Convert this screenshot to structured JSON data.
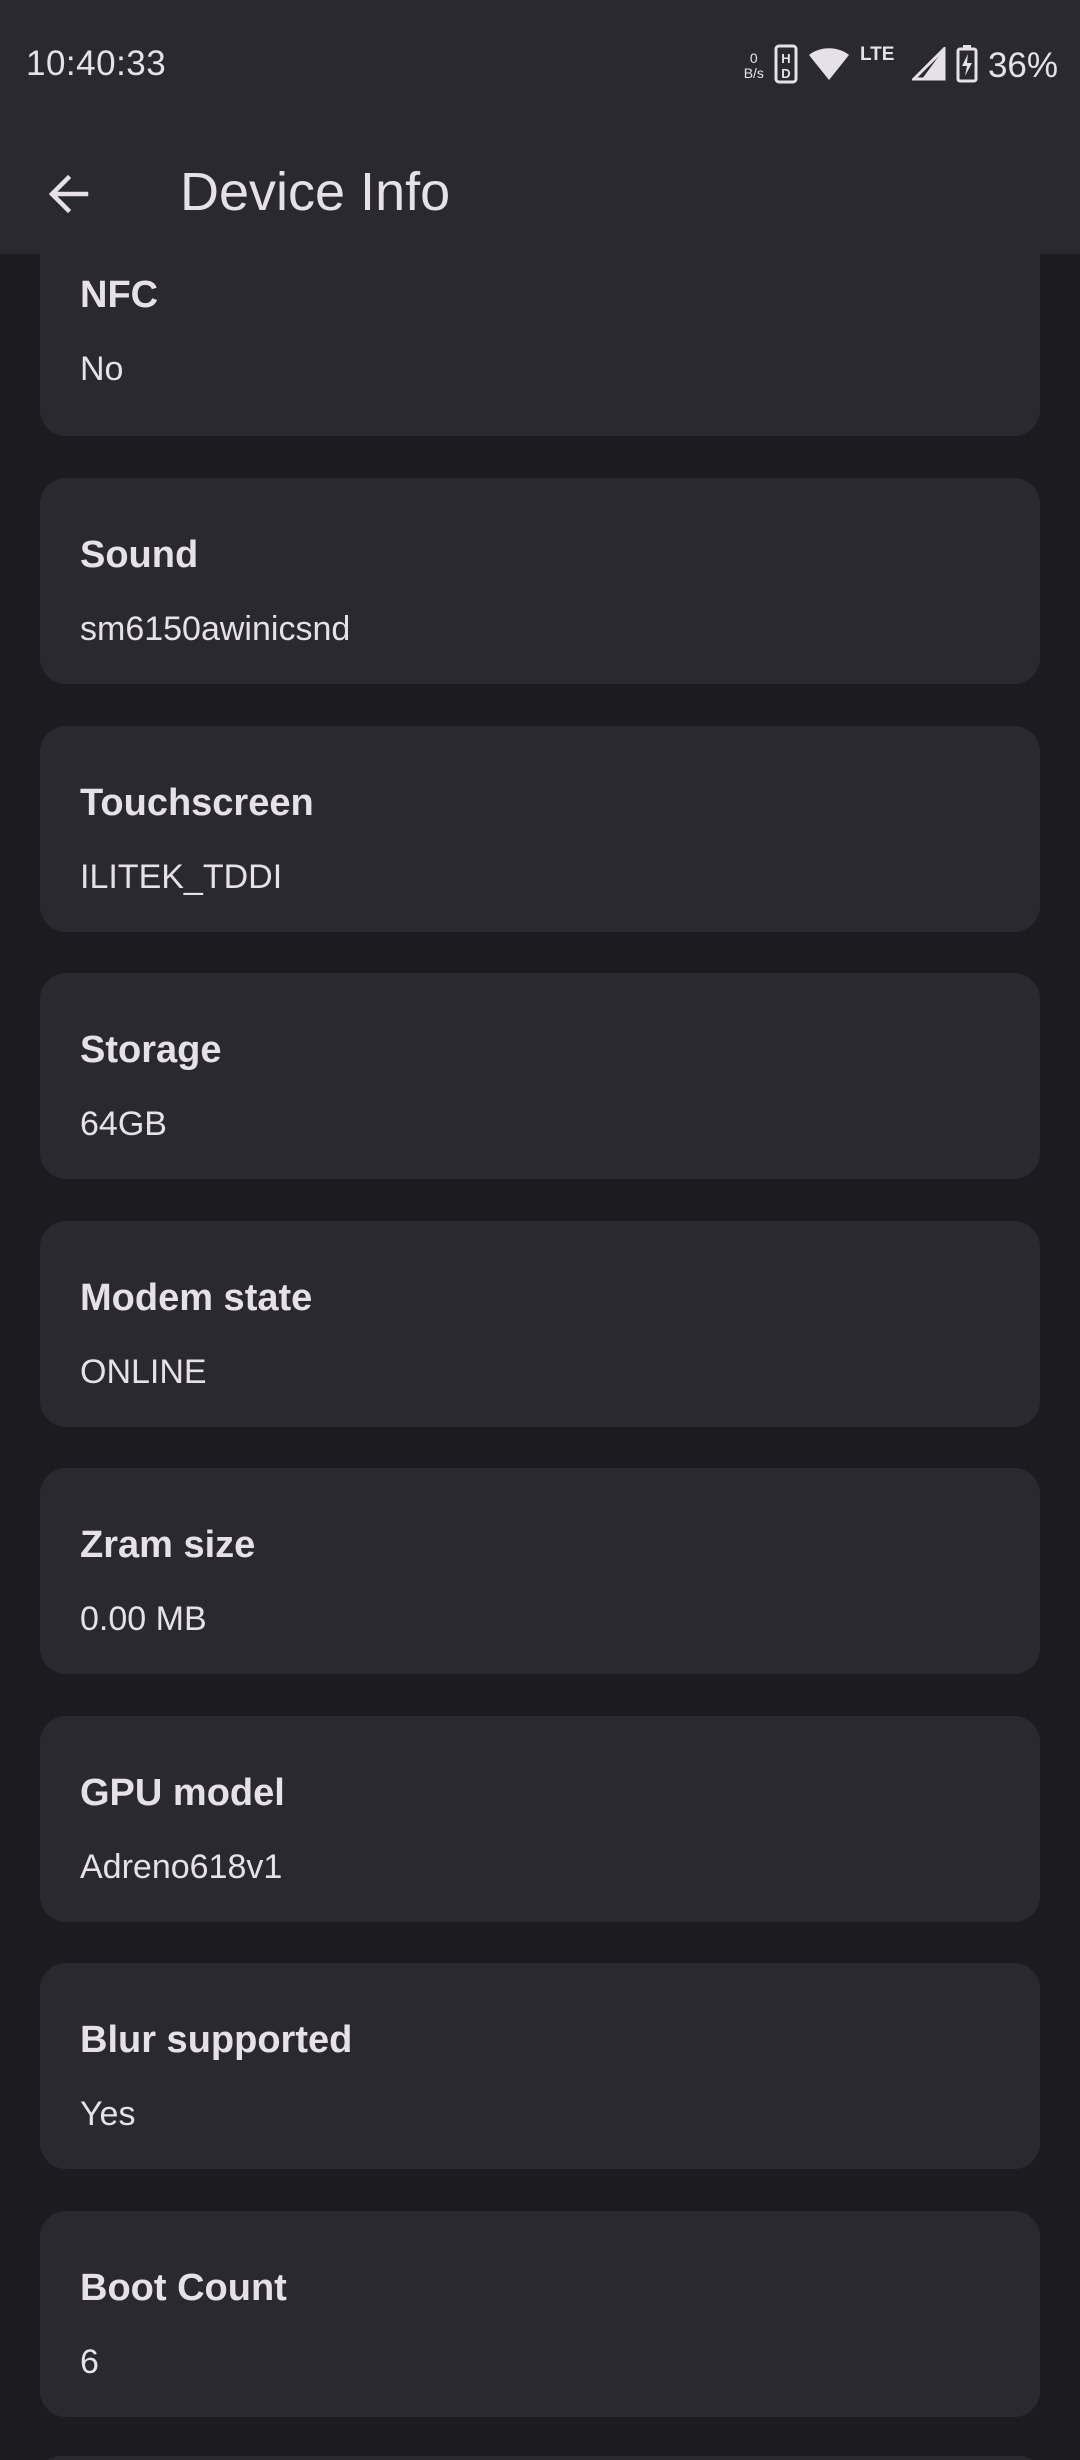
{
  "status_bar": {
    "time": "10:40:33",
    "net_speed_value": "0",
    "net_speed_unit": "B/s",
    "network_type": "LTE",
    "battery": "36%"
  },
  "app_bar": {
    "title": "Device Info"
  },
  "cards": [
    {
      "label": "NFC",
      "value": "No"
    },
    {
      "label": "Sound",
      "value": "sm6150awinicsnd"
    },
    {
      "label": "Touchscreen",
      "value": "ILITEK_TDDI"
    },
    {
      "label": "Storage",
      "value": "64GB"
    },
    {
      "label": "Modem state",
      "value": "ONLINE"
    },
    {
      "label": "Zram size",
      "value": "0.00 MB"
    },
    {
      "label": "GPU model",
      "value": "Adreno618v1"
    },
    {
      "label": "Blur supported",
      "value": "Yes"
    },
    {
      "label": "Boot Count",
      "value": "6"
    }
  ],
  "colors": {
    "background": "#1c1b20",
    "surface": "#2a2930",
    "text": "#e6e1e9"
  }
}
